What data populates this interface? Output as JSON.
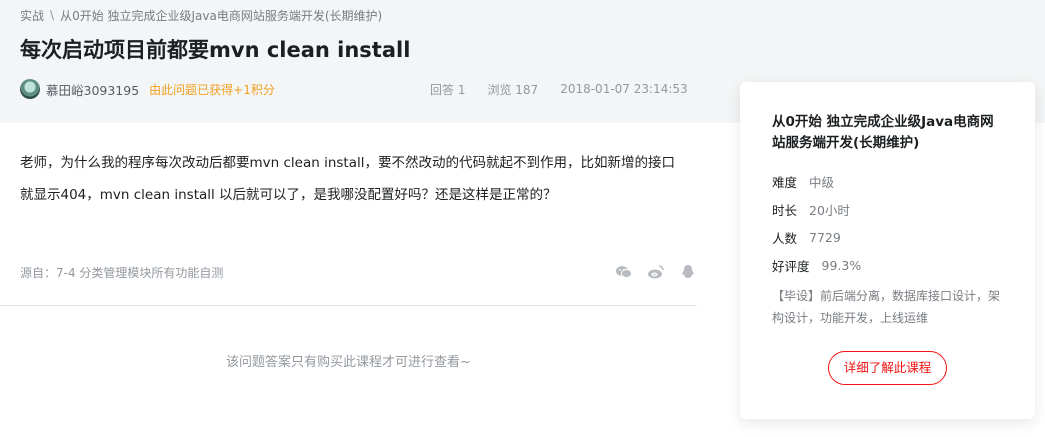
{
  "breadcrumb": {
    "items": [
      "实战",
      "从0开始 独立完成企业级Java电商网站服务端开发(长期维护)"
    ],
    "separator": "\\"
  },
  "question": {
    "title": "每次启动项目前都要mvn clean install",
    "username": "慕田峪3093195",
    "points_text": "由此问题已获得+1积分",
    "answers": "回答 1",
    "views": "浏览 187",
    "datetime": "2018-01-07 23:14:53",
    "body": "老师，为什么我的程序每次改动后都要mvn clean install，要不然改动的代码就起不到作用，比如新增的接口就显示404，mvn clean install 以后就可以了，是我哪没配置好吗？还是这样是正常的？",
    "source": "源自：7-4 分类管理模块所有功能自测",
    "notice": "该问题答案只有购买此课程才可进行查看~"
  },
  "share_icons": [
    "wechat-icon",
    "weibo-icon",
    "qq-icon"
  ],
  "course_card": {
    "title": "从0开始 独立完成企业级Java电商网站服务端开发(长期维护)",
    "info": [
      {
        "label": "难度",
        "value": "中级"
      },
      {
        "label": "时长",
        "value": "20小时"
      },
      {
        "label": "人数",
        "value": "7729"
      },
      {
        "label": "好评度",
        "value": "99.3%"
      }
    ],
    "description": "【毕设】前后端分离，数据库接口设计，架构设计，功能开发，上线运维",
    "button_label": "详细了解此课程"
  },
  "colors": {
    "accent": "#f01414",
    "points": "#f0a020",
    "muted": "#93999f",
    "band": "#f3f5f6"
  }
}
